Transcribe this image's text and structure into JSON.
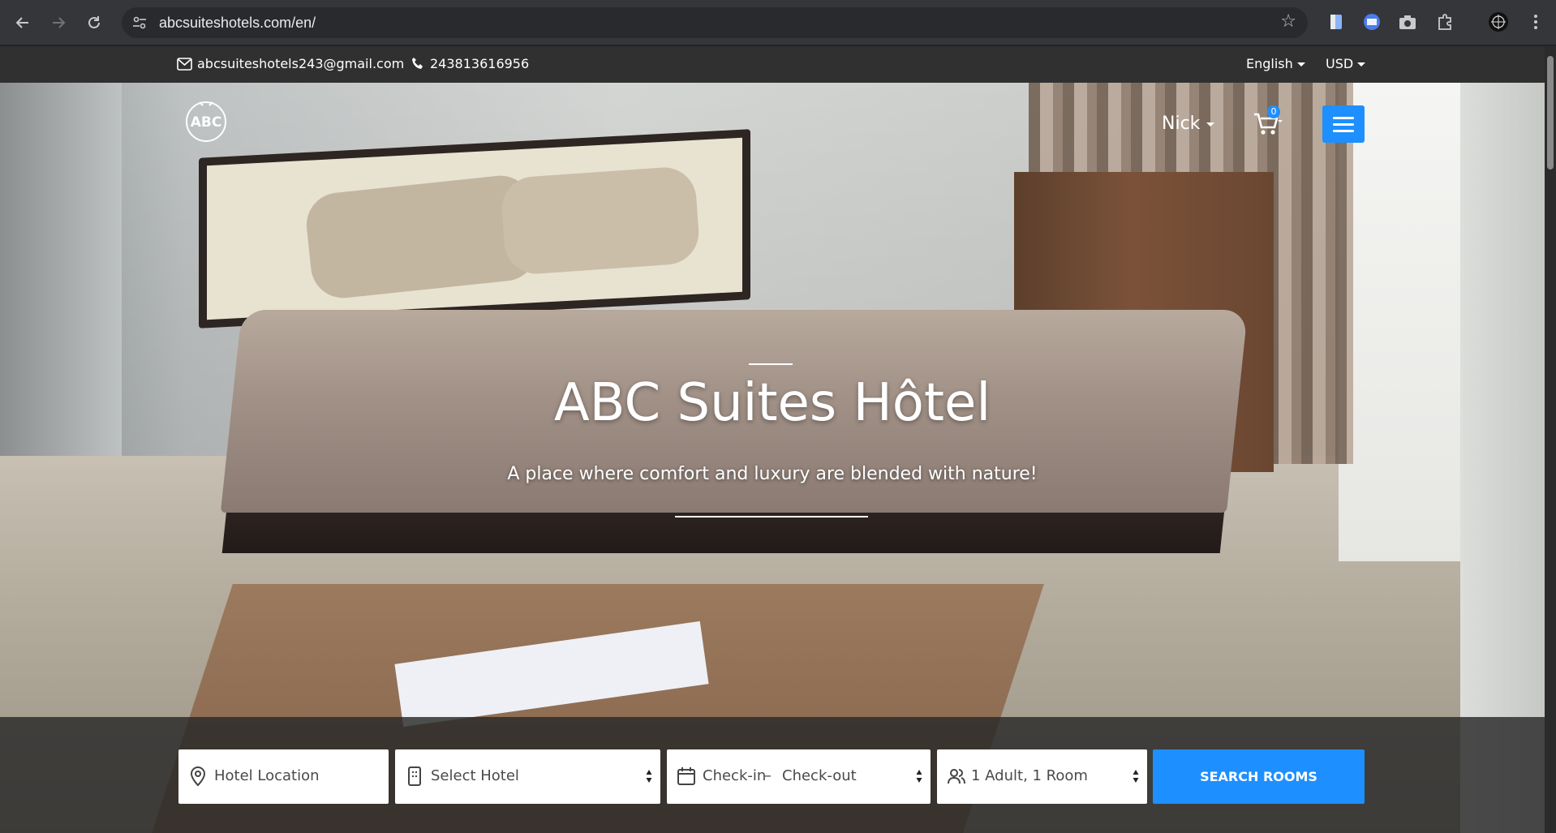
{
  "browser": {
    "url": "abcsuiteshotels.com/en/",
    "icons": [
      "back-icon",
      "forward-icon",
      "reload-icon",
      "site-info-icon",
      "bookmark-star-icon",
      "extension-icons",
      "puzzle-icon",
      "profile-icon",
      "more-icon"
    ]
  },
  "topbar": {
    "email": "abcsuiteshotels243@gmail.com",
    "phone": "243813616956",
    "language": "English",
    "currency": "USD"
  },
  "header": {
    "logo_text": "ABC",
    "user_name": "Nick",
    "cart_count": "0"
  },
  "hero": {
    "title": "ABC Suites Hôtel",
    "subtitle": "A place where comfort and luxury are blended with nature!"
  },
  "search": {
    "location_placeholder": "Hotel Location",
    "hotel_select": "Select Hotel",
    "check_in": "Check-in",
    "dash": "–",
    "check_out": "Check-out",
    "occupancy": "1 Adult, 1 Room",
    "button_label": "SEARCH ROOMS"
  },
  "colors": {
    "accent": "#1e8fff",
    "topbar_bg": "#303030",
    "chrome_bg": "#35363a"
  }
}
